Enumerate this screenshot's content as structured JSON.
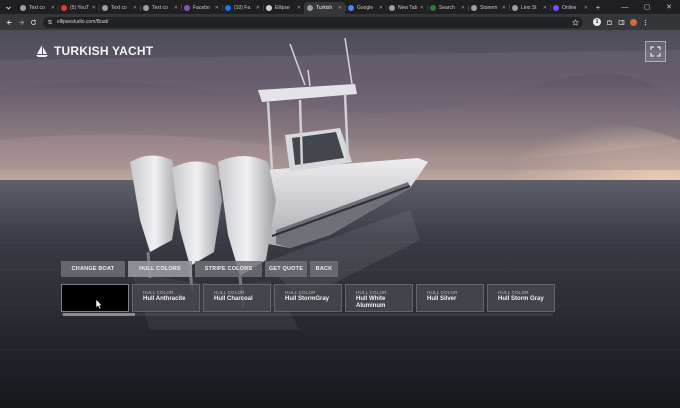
{
  "browser": {
    "tabs": [
      {
        "title": "Text co",
        "active": false,
        "color": "#9aa0a6"
      },
      {
        "title": "(5) YouT",
        "active": false,
        "color": "#e53935"
      },
      {
        "title": "Text co",
        "active": false,
        "color": "#9aa0a6"
      },
      {
        "title": "Text co",
        "active": false,
        "color": "#9aa0a6"
      },
      {
        "title": "Facebo",
        "active": false,
        "color": "#7e57c2"
      },
      {
        "title": "(10) Fa",
        "active": false,
        "color": "#1877f2"
      },
      {
        "title": "Ellipse",
        "active": false,
        "color": "#cfcfcf"
      },
      {
        "title": "Turkish",
        "active": true,
        "color": "#9aa0a6"
      },
      {
        "title": "Google",
        "active": false,
        "color": "#4285f4"
      },
      {
        "title": "New Tab",
        "active": false,
        "color": "#9aa0a6"
      },
      {
        "title": "Search",
        "active": false,
        "color": "#2e7d32"
      },
      {
        "title": "Stonem",
        "active": false,
        "color": "#9aa0a6"
      },
      {
        "title": "Lino St",
        "active": false,
        "color": "#9aa0a6"
      },
      {
        "title": "Online",
        "active": false,
        "color": "#7c4dff"
      }
    ],
    "url": "ellipsestudio.com/Boat/",
    "extension_badge": "1"
  },
  "app": {
    "title": "TURKISH YACHT",
    "menu": [
      {
        "label": "CHANGE BOAT",
        "active": false
      },
      {
        "label": "HULL COLORS",
        "active": true
      },
      {
        "label": "STRIPE COLORS",
        "active": false
      },
      {
        "label": "GET QUOTE",
        "active": false
      },
      {
        "label": "BACK",
        "active": false
      }
    ],
    "swatches": [
      {
        "caption": "",
        "name": "",
        "selected": true
      },
      {
        "caption": "HULL COLOR",
        "name": "Hull Anthracite",
        "selected": false
      },
      {
        "caption": "HULL COLOR",
        "name": "Hull Charcoal",
        "selected": false
      },
      {
        "caption": "HULL COLOR",
        "name": "Hull StormGray",
        "selected": false
      },
      {
        "caption": "HULL COLOR",
        "name": "Hull White Aluminum",
        "selected": false
      },
      {
        "caption": "HULL COLOR",
        "name": "Hull Silver",
        "selected": false
      },
      {
        "caption": "HULL COLOR",
        "name": "Hull Storm Gray",
        "selected": false
      }
    ]
  }
}
